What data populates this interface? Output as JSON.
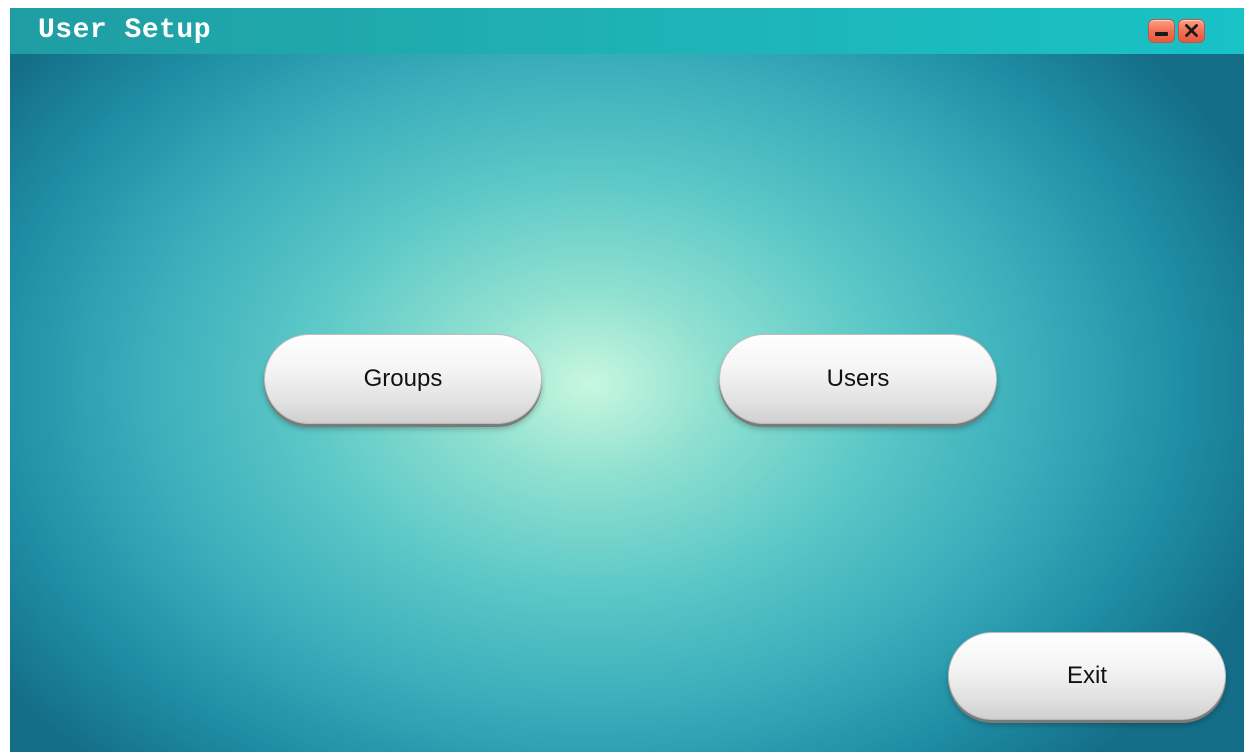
{
  "window": {
    "title": "User Setup"
  },
  "titlebar_buttons": {
    "minimize_icon": "minimize-icon",
    "close_icon": "close-icon"
  },
  "buttons": {
    "groups": "Groups",
    "users": "Users",
    "exit": "Exit"
  },
  "colors": {
    "titlebar": "#1fb0b3",
    "window_controls": "#f06e52",
    "background_center": "#c8f7e0",
    "background_edge": "#156e88"
  }
}
